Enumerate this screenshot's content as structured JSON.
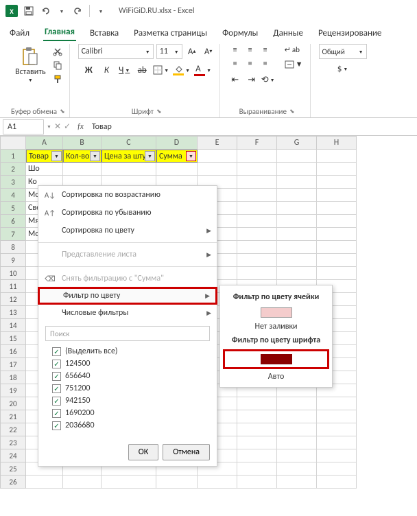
{
  "title": "WiFiGiD.RU.xlsx - Excel",
  "menu": {
    "file": "Файл",
    "home": "Главная",
    "insert": "Вставка",
    "layout": "Разметка страницы",
    "formulas": "Формулы",
    "data": "Данные",
    "review": "Рецензирование"
  },
  "ribbon": {
    "paste": "Вставить",
    "clipboard": "Буфер обмена",
    "font_name": "Calibri",
    "font_size": "11",
    "font_group": "Шрифт",
    "bold": "Ж",
    "italic": "К",
    "underline": "Ч",
    "align_group": "Выравнивание",
    "wrap": "ab",
    "num_format": "Общий"
  },
  "namebox": "A1",
  "fx": "fx",
  "formula": "Товар",
  "cols": [
    "A",
    "B",
    "C",
    "D",
    "E",
    "F",
    "G",
    "H"
  ],
  "widths": [
    54,
    56,
    80,
    60,
    58,
    58,
    58,
    58
  ],
  "headers": {
    "a": "Товар",
    "b": "Кол-во",
    "c": "Цена за шту",
    "d": "Сумма"
  },
  "rowsA": [
    "Шо",
    "Ко",
    "Мо",
    "Све",
    "Мя",
    "Мо"
  ],
  "ctx": {
    "sort_asc": "Сортировка по возрастанию",
    "sort_desc": "Сортировка по убыванию",
    "sort_color": "Сортировка по цвету",
    "view": "Представление листа",
    "clear": "Снять фильтрацию с \"Сумма\"",
    "filter_color": "Фильтр по цвету",
    "num_filter": "Числовые фильтры",
    "search": "Поиск",
    "select_all": "(Выделить все)",
    "values": [
      "124500",
      "656640",
      "751200",
      "942150",
      "1690200",
      "2036680"
    ],
    "ok": "ОК",
    "cancel": "Отмена"
  },
  "sub": {
    "cell_color": "Фильтр по цвету ячейки",
    "no_fill": "Нет заливки",
    "font_color": "Фильтр по цвету шрифта",
    "auto": "Авто"
  }
}
